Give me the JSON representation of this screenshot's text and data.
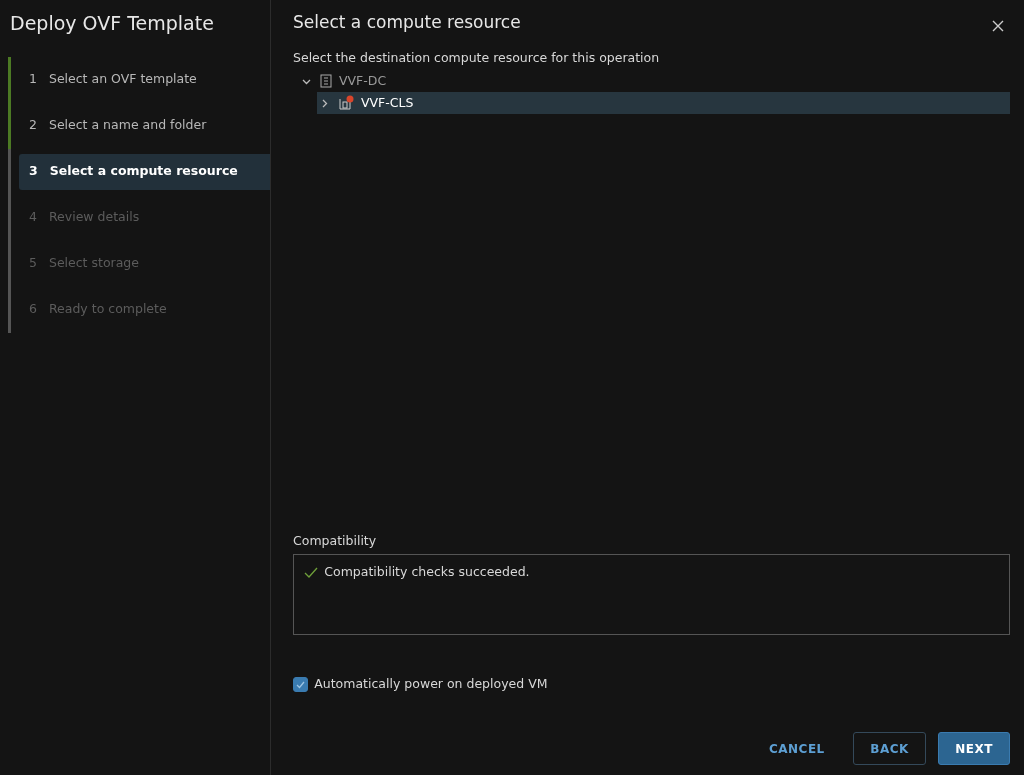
{
  "wizard": {
    "title": "Deploy OVF Template"
  },
  "steps": [
    {
      "number": "1",
      "label": "Select an OVF template",
      "selected": false,
      "completed": true,
      "disabled": false
    },
    {
      "number": "2",
      "label": "Select a name and folder",
      "selected": false,
      "completed": true,
      "disabled": false
    },
    {
      "number": "3",
      "label": "Select a compute resource",
      "selected": true,
      "completed": false,
      "disabled": false
    },
    {
      "number": "4",
      "label": "Review details",
      "selected": false,
      "completed": false,
      "disabled": true
    },
    {
      "number": "5",
      "label": "Select storage",
      "selected": false,
      "completed": false,
      "disabled": true
    },
    {
      "number": "6",
      "label": "Ready to complete",
      "selected": false,
      "completed": false,
      "disabled": true
    }
  ],
  "page": {
    "title": "Select a compute resource",
    "instruction": "Select the destination compute resource for this operation"
  },
  "tree": [
    {
      "label": "VVF-DC",
      "kind": "datacenter",
      "expanded": true,
      "selected": false,
      "children": [
        {
          "label": "VVF-CLS",
          "kind": "cluster",
          "expanded": false,
          "selected": true,
          "alert": true
        }
      ]
    }
  ],
  "compatibility": {
    "label": "Compatibility",
    "message": "Compatibility checks succeeded.",
    "passed": true
  },
  "power_on": {
    "label": "Automatically power on deployed VM",
    "checked": true
  },
  "buttons": [
    {
      "label": "CANCEL",
      "kind": "link"
    },
    {
      "label": "BACK",
      "kind": "outline"
    },
    {
      "label": "NEXT",
      "kind": "primary"
    }
  ]
}
